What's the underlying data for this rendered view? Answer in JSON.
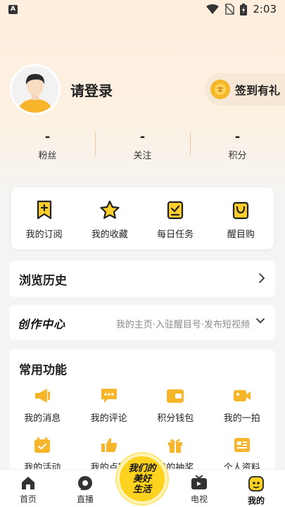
{
  "status_bar": {
    "time": "2:03"
  },
  "profile": {
    "login_label": "请登录",
    "signin_label": "签到有礼"
  },
  "stats": [
    {
      "value": "-",
      "label": "粉丝"
    },
    {
      "value": "-",
      "label": "关注"
    },
    {
      "value": "-",
      "label": "积分"
    }
  ],
  "quick_actions": [
    {
      "label": "我的订阅",
      "icon": "bookmark-plus-icon"
    },
    {
      "label": "我的收藏",
      "icon": "star-icon"
    },
    {
      "label": "每日任务",
      "icon": "task-check-icon"
    },
    {
      "label": "醒目购",
      "icon": "shopping-bag-icon"
    }
  ],
  "history": {
    "title": "浏览历史"
  },
  "creator": {
    "logo": "创作中心",
    "description": "我的主页·入驻醒目号·发布短视频"
  },
  "common": {
    "title": "常用功能",
    "items": [
      {
        "label": "我的消息",
        "icon": "megaphone-icon"
      },
      {
        "label": "我的评论",
        "icon": "comment-icon"
      },
      {
        "label": "积分钱包",
        "icon": "wallet-icon"
      },
      {
        "label": "我的一拍",
        "icon": "video-camera-icon"
      },
      {
        "label": "我的活动",
        "icon": "calendar-icon"
      },
      {
        "label": "我的点赞",
        "icon": "thumb-up-icon"
      },
      {
        "label": "我的抽奖",
        "icon": "gift-icon"
      },
      {
        "label": "个人资料",
        "icon": "profile-card-icon"
      }
    ]
  },
  "tabbar": {
    "tabs": [
      {
        "label": "首页",
        "icon": "home-icon"
      },
      {
        "label": "直播",
        "icon": "live-icon"
      },
      {
        "label": "电视",
        "icon": "tv-icon"
      },
      {
        "label": "我的",
        "icon": "me-icon"
      }
    ],
    "center_line1": "我们的",
    "center_line2": "美好",
    "center_line3": "生活"
  },
  "colors": {
    "accent": "#f5b82a",
    "header_bg": "#fdeedd",
    "divider": "#f2c89a"
  }
}
